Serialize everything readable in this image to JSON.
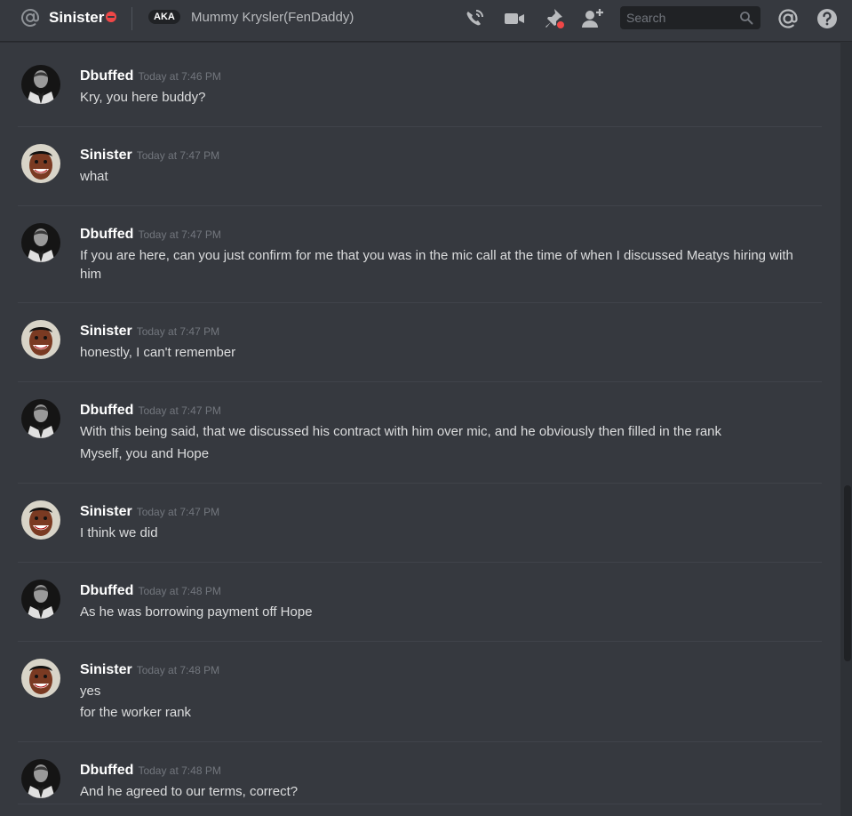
{
  "header": {
    "title": "Sinister",
    "status": "dnd",
    "aka_label": "AKA",
    "nickname": "Mummy Krysler(FenDaddy)",
    "search_placeholder": "Search",
    "icons": [
      "at-icon",
      "call-icon",
      "video-icon",
      "pin-icon",
      "add-friend-icon",
      "search-icon",
      "mention-icon",
      "help-icon"
    ]
  },
  "messages": [
    {
      "author": "Dbuffed",
      "timestamp": "Today at 7:46 PM",
      "lines": [
        "Kry, you here buddy?"
      ]
    },
    {
      "author": "Sinister",
      "timestamp": "Today at 7:47 PM",
      "lines": [
        "what"
      ]
    },
    {
      "author": "Dbuffed",
      "timestamp": "Today at 7:47 PM",
      "lines": [
        "If you are here, can you just confirm for me that you was in the mic call at the time of when I discussed Meatys hiring with him"
      ]
    },
    {
      "author": "Sinister",
      "timestamp": "Today at 7:47 PM",
      "lines": [
        "honestly, I can't remember"
      ]
    },
    {
      "author": "Dbuffed",
      "timestamp": "Today at 7:47 PM",
      "lines": [
        "With this being said, that we discussed his contract with him over mic, and he obviously then filled in the rank",
        "Myself, you and Hope"
      ]
    },
    {
      "author": "Sinister",
      "timestamp": "Today at 7:47 PM",
      "lines": [
        "I think we did"
      ]
    },
    {
      "author": "Dbuffed",
      "timestamp": "Today at 7:48 PM",
      "lines": [
        "As he was borrowing payment off Hope"
      ]
    },
    {
      "author": "Sinister",
      "timestamp": "Today at 7:48 PM",
      "lines": [
        "yes",
        "for the worker rank"
      ]
    },
    {
      "author": "Dbuffed",
      "timestamp": "Today at 7:48 PM",
      "lines": [
        "And he agreed to our terms, correct?"
      ]
    }
  ],
  "colors": {
    "background": "#36393f",
    "header_text": "#ffffff",
    "message_text": "#dcddde",
    "timestamp": "#72767d",
    "dnd_status": "#f04747",
    "notification_dot": "#f04747"
  }
}
